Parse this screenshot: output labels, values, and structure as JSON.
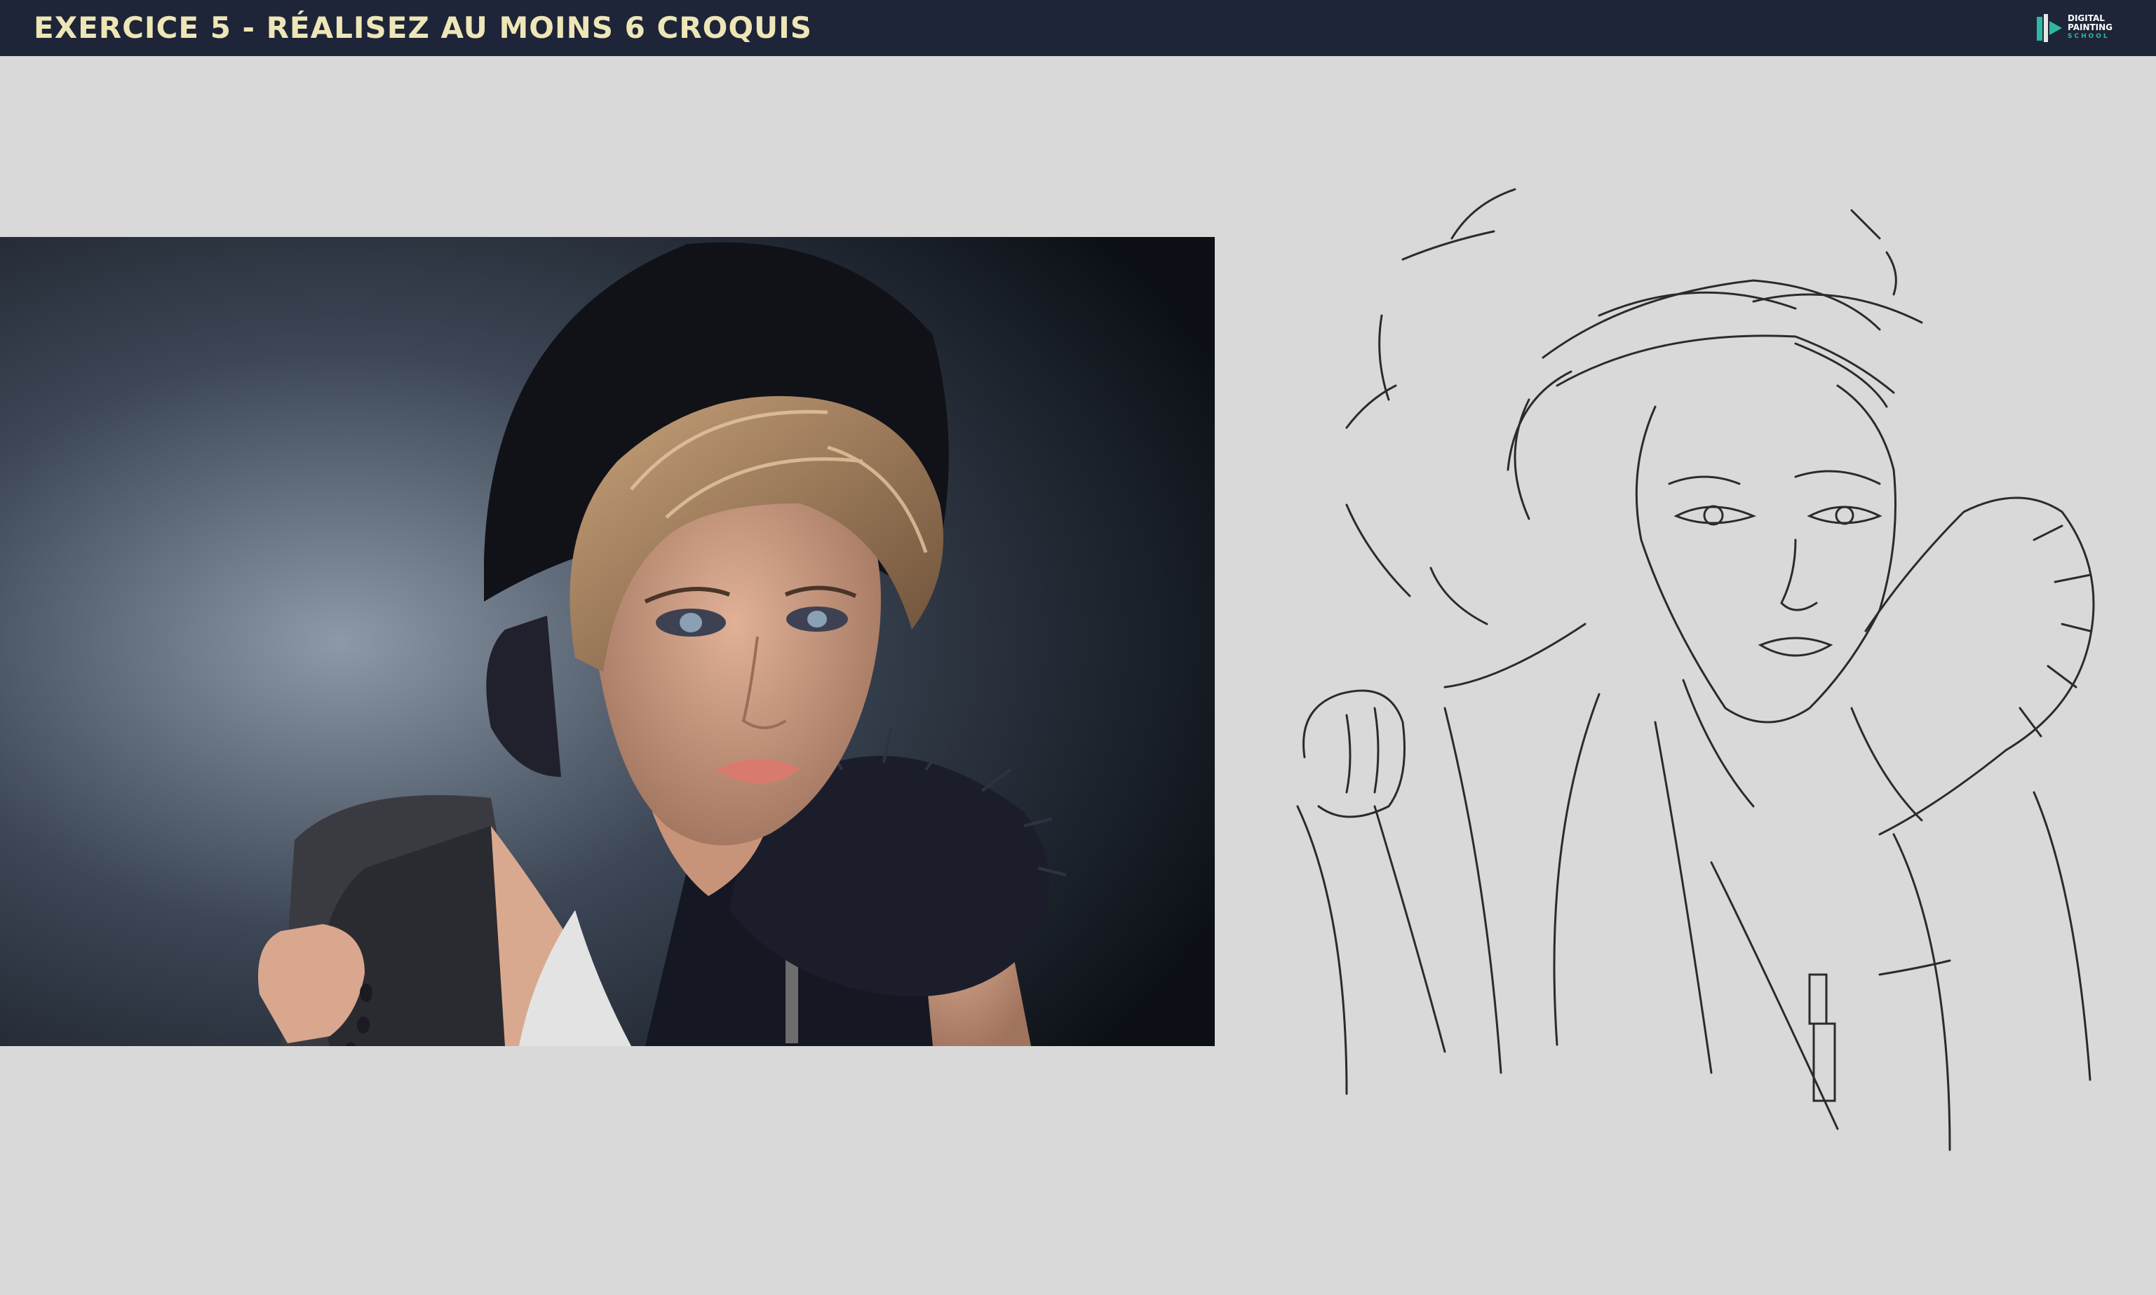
{
  "header": {
    "title": "EXERCICE 5 - RÉALISEZ AU MOINS 6 CROQUIS",
    "logo": {
      "line1": "DIGITAL",
      "line2": "PAINTING",
      "line3": "SCHOOL",
      "icon": "brush-icon"
    }
  },
  "images": {
    "reference": "reference-photo",
    "sketch": "line-sketch"
  },
  "colors": {
    "topbar": "#1e2538",
    "title": "#efe6b8",
    "background": "#d9d9d9",
    "logo_accent": "#2fb7a4"
  }
}
